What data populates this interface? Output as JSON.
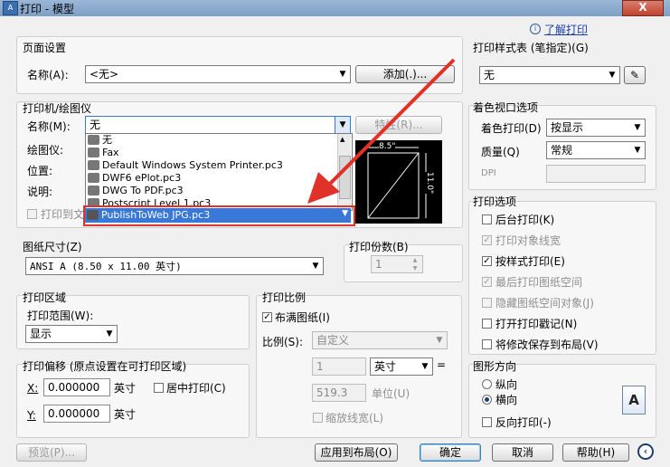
{
  "window": {
    "title": "打印 - 模型",
    "close": "X"
  },
  "help_link": "了解打印",
  "page_setup": {
    "group": "页面设置",
    "name_label": "名称(A):",
    "name_value": "<无>",
    "add_button": "添加(.)..."
  },
  "printer": {
    "group": "打印机/绘图仪",
    "name_label": "名称(M):",
    "name_value": "无",
    "properties_button": "特性(R)...",
    "plotter_label": "绘图仪:",
    "location_label": "位置:",
    "description_label": "说明:",
    "print_to_file": "打印到文件",
    "dropdown_items": [
      "无",
      "Fax",
      "Default Windows System Printer.pc3",
      "DWF6 ePlot.pc3",
      "DWG To PDF.pc3",
      "Postscript Level 1.pc3"
    ],
    "selected_item": "PublishToWeb JPG.pc3",
    "preview_width": "8.5\"",
    "preview_height": "11.0\""
  },
  "paper_size": {
    "group": "图纸尺寸(Z)",
    "value": "ANSI A (8.50 x 11.00 英寸)"
  },
  "copies": {
    "group": "打印份数(B)",
    "value": "1"
  },
  "plot_area": {
    "group": "打印区域",
    "range_label": "打印范围(W):",
    "range_value": "显示"
  },
  "plot_offset": {
    "group": "打印偏移 (原点设置在可打印区域)",
    "x_label": "X:",
    "x_value": "0.000000",
    "x_unit": "英寸",
    "y_label": "Y:",
    "y_value": "0.000000",
    "y_unit": "英寸",
    "center": "居中打印(C)"
  },
  "plot_scale": {
    "group": "打印比例",
    "fit_paper": "布满图纸(I)",
    "scale_label": "比例(S):",
    "scale_value": "自定义",
    "num_value": "1",
    "unit_value": "英寸",
    "equals": "=",
    "den_value": "519.3",
    "unit_label": "单位(U)",
    "scale_lineweights": "缩放线宽(L)"
  },
  "plot_style": {
    "group": "打印样式表 (笔指定)(G)",
    "value": "无"
  },
  "shaded_viewport": {
    "group": "着色视口选项",
    "shade_label": "着色打印(D)",
    "shade_value": "按显示",
    "quality_label": "质量(Q)",
    "quality_value": "常规",
    "dpi_label": "DPI"
  },
  "plot_options": {
    "group": "打印选项",
    "items": [
      {
        "label": "后台打印(K)",
        "checked": false,
        "disabled": false
      },
      {
        "label": "打印对象线宽",
        "checked": true,
        "disabled": true
      },
      {
        "label": "按样式打印(E)",
        "checked": true,
        "disabled": false
      },
      {
        "label": "最后打印图纸空间",
        "checked": true,
        "disabled": true
      },
      {
        "label": "隐藏图纸空间对象(J)",
        "checked": false,
        "disabled": true
      },
      {
        "label": "打开打印戳记(N)",
        "checked": false,
        "disabled": false
      },
      {
        "label": "将修改保存到布局(V)",
        "checked": false,
        "disabled": false
      }
    ]
  },
  "orientation": {
    "group": "图形方向",
    "portrait": "纵向",
    "landscape": "横向",
    "upside_down": "反向打印(-)",
    "selected": "landscape"
  },
  "footer": {
    "preview": "预览(P)...",
    "apply_layout": "应用到布局(O)",
    "ok": "确定",
    "cancel": "取消",
    "help": "帮助(H)"
  },
  "colors": {
    "accent_red": "#e0312a",
    "selected_blue": "#3a78d8"
  }
}
